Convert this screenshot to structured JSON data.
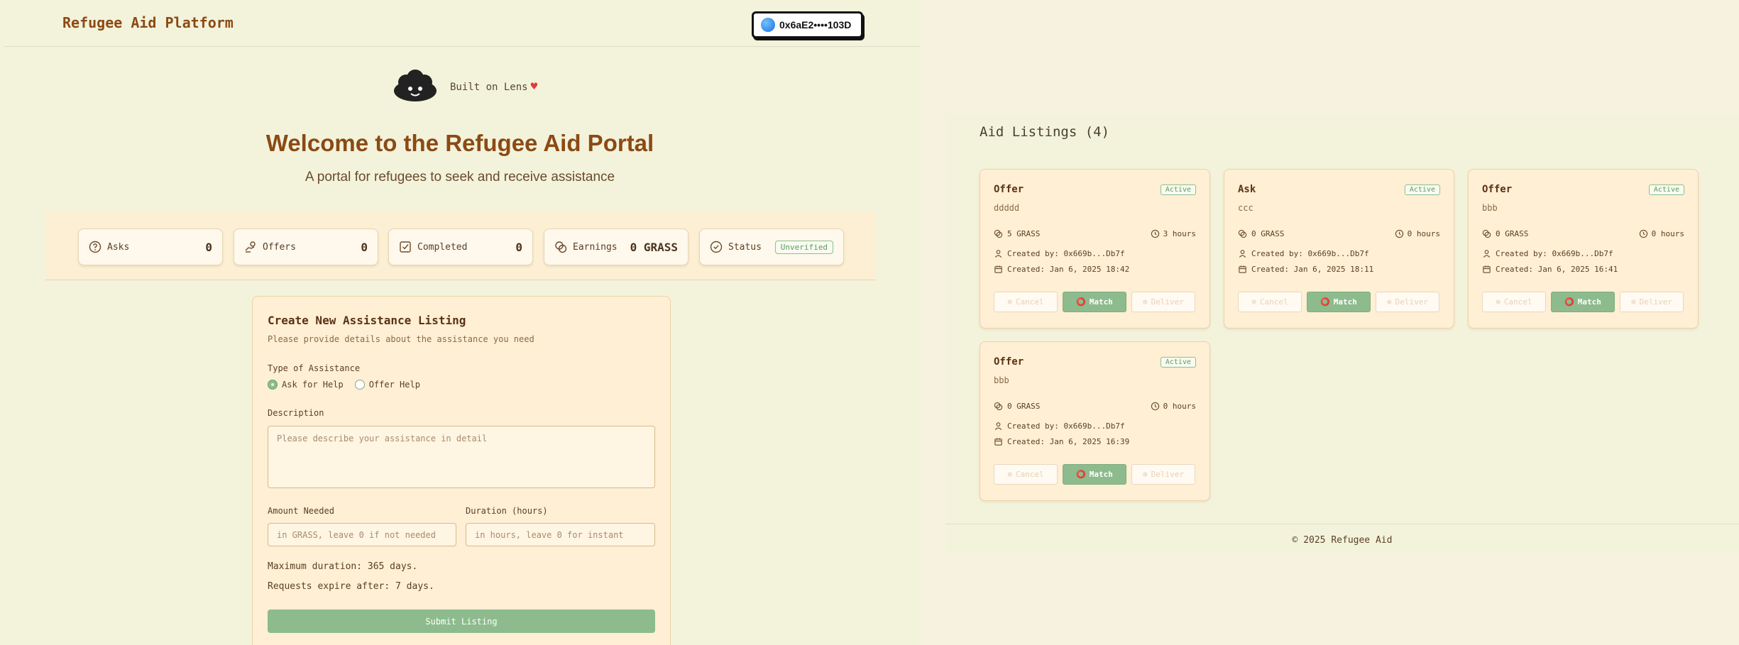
{
  "header": {
    "brand": "Refugee Aid Platform",
    "wallet": "0x6aE2••••103D"
  },
  "lens": {
    "text": "Built on Lens",
    "heart": "♥"
  },
  "hero": {
    "title": "Welcome to the Refugee Aid Portal",
    "subtitle": "A portal for refugees to seek and receive assistance"
  },
  "stats": [
    {
      "label": "Asks",
      "value": "0",
      "icon": "question-icon"
    },
    {
      "label": "Offers",
      "value": "0",
      "icon": "hand-coins-icon"
    },
    {
      "label": "Completed",
      "value": "0",
      "icon": "check-square-icon"
    },
    {
      "label": "Earnings",
      "value": "0 GRASS",
      "icon": "coins-icon"
    },
    {
      "label": "Status",
      "value": "Unverified",
      "icon": "check-circle-icon"
    }
  ],
  "form": {
    "title": "Create New Assistance Listing",
    "subtitle": "Please provide details about the assistance you need",
    "type_label": "Type of Assistance",
    "options": [
      "Ask for Help",
      "Offer Help"
    ],
    "selected": "Ask for Help",
    "description_label": "Description",
    "description_placeholder": "Please describe your assistance in detail",
    "amount_label": "Amount Needed",
    "amount_placeholder": "in GRASS, leave 0 if not needed",
    "duration_label": "Duration (hours)",
    "duration_placeholder": "in hours, leave 0 for instant",
    "info_max": "Maximum duration: 365 days.",
    "info_expire": "Requests expire after: 7 days.",
    "submit": "Submit Listing"
  },
  "listings": {
    "title": "Aid Listings (4)",
    "cards": [
      {
        "type": "Offer",
        "status": "Active",
        "desc": "ddddd",
        "amount": "5 GRASS",
        "duration": "3 hours",
        "creator": "Created by: 0x669b...Db7f",
        "created": "Created: Jan 6, 2025 18:42",
        "cancel": "Cancel",
        "match": "Match",
        "deliver": "Deliver"
      },
      {
        "type": "Ask",
        "status": "Active",
        "desc": "ccc",
        "amount": "0 GRASS",
        "duration": "0 hours",
        "creator": "Created by: 0x669b...Db7f",
        "created": "Created: Jan 6, 2025 18:11",
        "cancel": "Cancel",
        "match": "Match",
        "deliver": "Deliver"
      },
      {
        "type": "Offer",
        "status": "Active",
        "desc": "bbb",
        "amount": "0 GRASS",
        "duration": "0 hours",
        "creator": "Created by: 0x669b...Db7f",
        "created": "Created: Jan 6, 2025 16:41",
        "cancel": "Cancel",
        "match": "Match",
        "deliver": "Deliver"
      },
      {
        "type": "Offer",
        "status": "Active",
        "desc": "bbb",
        "amount": "0 GRASS",
        "duration": "0 hours",
        "creator": "Created by: 0x669b...Db7f",
        "created": "Created: Jan 6, 2025 16:39",
        "cancel": "Cancel",
        "match": "Match",
        "deliver": "Deliver"
      }
    ]
  },
  "footer": "© 2025 Refugee Aid",
  "colors": {
    "brand": "#8b4a14",
    "accent_green": "#8dbb8d",
    "card_bg": "#ffefd4",
    "page_bg": "#f3f3dc"
  }
}
